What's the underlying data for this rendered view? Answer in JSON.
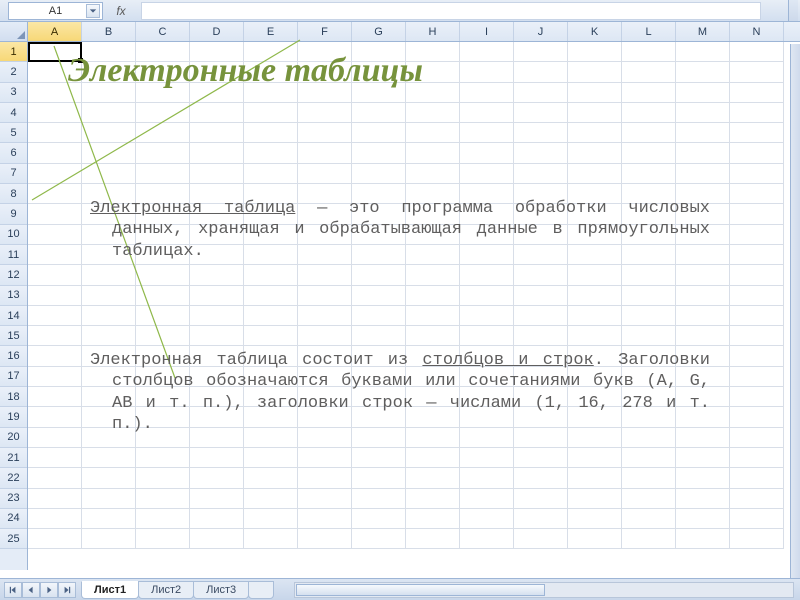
{
  "namebox": {
    "value": "A1"
  },
  "formula_bar": {
    "fx": "fx",
    "value": ""
  },
  "columns": [
    "A",
    "B",
    "C",
    "D",
    "E",
    "F",
    "G",
    "H",
    "I",
    "J",
    "K",
    "L",
    "M",
    "N"
  ],
  "rows": [
    "1",
    "2",
    "3",
    "4",
    "5",
    "6",
    "7",
    "8",
    "9",
    "10",
    "11",
    "12",
    "13",
    "14",
    "15",
    "16",
    "17",
    "18",
    "19",
    "20",
    "21",
    "22",
    "23",
    "24",
    "25"
  ],
  "selected_col": "A",
  "selected_row": "1",
  "title": "Электронные таблицы",
  "para1_u": "Электронная таблица",
  "para1_rest": " — это программа обработки числовых данных, хранящая и обрабатывающая данные в прямоугольных таблицах.",
  "para2_a": "Электронная таблица состоит из ",
  "para2_u": "столбцов и строк",
  "para2_b": ". Заголовки столбцов обозначаются буквами или сочетаниями букв (A, G, АВ и т. п.), заголовки строк — числами (1, 16, 278 и т. п.).",
  "tabs": [
    {
      "label": "Лист1",
      "active": true
    },
    {
      "label": "Лист2",
      "active": false
    },
    {
      "label": "Лист3",
      "active": false
    }
  ]
}
